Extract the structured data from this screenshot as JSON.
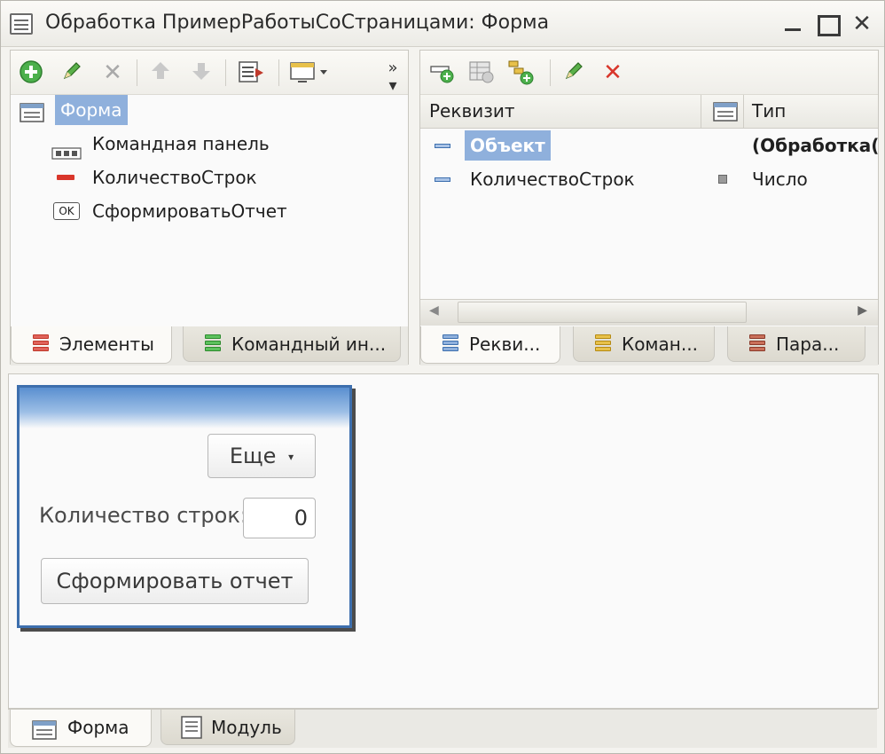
{
  "window": {
    "title": "Обработка ПримерРаботыСоСтраницами: Форма"
  },
  "elements_panel": {
    "toolbar_icons": [
      "add-icon",
      "edit-icon",
      "delete-icon",
      "move-up-icon",
      "move-down-icon",
      "command-icon",
      "display-mode-icon",
      "more-icon"
    ],
    "tree": {
      "root": "Форма",
      "items": [
        {
          "label": "Командная панель",
          "icon": "command-panel-icon"
        },
        {
          "label": "КоличествоСтрок",
          "icon": "field-icon"
        },
        {
          "label": "СформироватьОтчет",
          "icon": "button-ok-icon",
          "icon_text": "OK"
        }
      ]
    },
    "tabs": [
      {
        "label": "Элементы",
        "active": true
      },
      {
        "label": "Командный ин...",
        "active": false
      }
    ]
  },
  "attributes_panel": {
    "toolbar_icons": [
      "add-attribute-icon",
      "add-table-icon",
      "add-column-icon",
      "edit-icon",
      "delete-icon"
    ],
    "columns": {
      "name": "Реквизит",
      "type": "Тип"
    },
    "rows": [
      {
        "name": "Объект",
        "type": "(Обработка(",
        "selected": true
      },
      {
        "name": "КоличествоСтрок",
        "type": "Число",
        "selected": false
      }
    ],
    "tabs": [
      {
        "label": "Рекви...",
        "active": true
      },
      {
        "label": "Коман...",
        "active": false
      },
      {
        "label": "Пара...",
        "active": false
      }
    ]
  },
  "preview_form": {
    "more_button": "Еще",
    "field_label": "Количество строк:",
    "field_value": "0",
    "submit_button": "Сформировать отчет"
  },
  "bottom_tabs": [
    {
      "label": "Форма",
      "active": true
    },
    {
      "label": "Модуль",
      "active": false
    }
  ],
  "colors": {
    "selection": "#8fb0dc",
    "accent_blue": "#3d6fae",
    "delete_red": "#d9362b",
    "add_green": "#3aa43a"
  }
}
